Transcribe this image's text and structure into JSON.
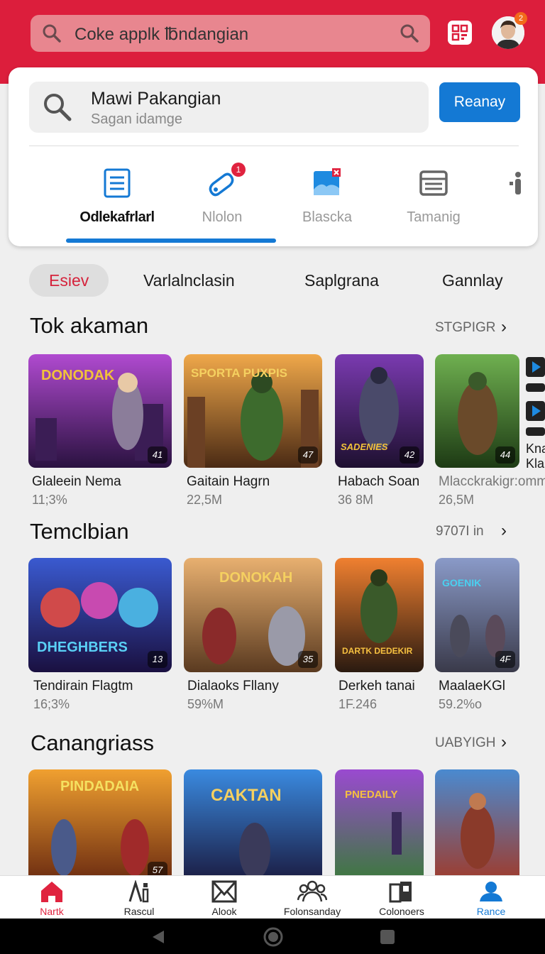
{
  "header": {
    "search_text": "Coke applk ℔ndangian"
  },
  "notification_count": "2",
  "card": {
    "search_title": "Mawi Pakangian",
    "search_sub": "Sagan idamge",
    "button": "Reanay",
    "tabs": [
      {
        "label": "Odlekafrlarl",
        "icon": "document-icon",
        "active": true
      },
      {
        "label": "Nlolon",
        "icon": "controller-icon",
        "badge": "1"
      },
      {
        "label": "Blascka",
        "icon": "image-icon"
      },
      {
        "label": "Tamanig",
        "icon": "folder-icon"
      }
    ]
  },
  "chips": [
    "Esiev",
    "Varlalnclasin",
    "Saplgrana",
    "Gannlay"
  ],
  "sections": [
    {
      "title": "Tok akaman",
      "more": "STGPIGR",
      "items": [
        {
          "name": "Glaleein Nema",
          "size": "11;3%",
          "badge": "41",
          "art": "DONODAK"
        },
        {
          "name": "Gaitain Hagrn",
          "size": "22,5M",
          "badge": "47",
          "art": "SPORTA PUXPIS"
        },
        {
          "name": "Habach Soan",
          "size": "36 8M",
          "badge": "42",
          "art": "SADENIES"
        },
        {
          "name": "Mlacckrakigr:omm",
          "size": "26,5M",
          "badge": "44",
          "art": ""
        }
      ],
      "peek_text": [
        "Kna",
        "Kla"
      ]
    },
    {
      "title": "Temclbian",
      "more": "9707I in",
      "items": [
        {
          "name": "Tendirain Flagtm",
          "size": "16;3%",
          "badge": "13",
          "art": "DHEGHBERS"
        },
        {
          "name": "Dialaoks Fllany",
          "size": "59%M",
          "badge": "35",
          "art": "DONOKAH"
        },
        {
          "name": "Derkeh tanai",
          "size": "1F.246",
          "badge": "",
          "art": "DARTK DEDEKIR"
        },
        {
          "name": "MaalaeKGl",
          "size": "59.2%o",
          "badge": "4F",
          "art": "GOENIK"
        }
      ]
    },
    {
      "title": "Canangriass",
      "more": "UABYIGH",
      "items": [
        {
          "art": "PINDADAIA",
          "badge": "57"
        },
        {
          "art": "CAKTAN",
          "badge": ""
        },
        {
          "art": "PNEDAILY",
          "badge": ""
        },
        {
          "art": "",
          "badge": ""
        }
      ]
    }
  ],
  "bottom_nav": [
    {
      "label": "Nartk",
      "icon": "home-icon",
      "active": true
    },
    {
      "label": "Rascul",
      "icon": "info-icon"
    },
    {
      "label": "Alook",
      "icon": "mail-icon"
    },
    {
      "label": "Folonsanday",
      "icon": "people-icon"
    },
    {
      "label": "Colonoers",
      "icon": "library-icon"
    },
    {
      "label": "Rance",
      "icon": "profile-icon"
    }
  ],
  "colors": {
    "brand_red": "#dc1e3c",
    "accent_blue": "#1479d4",
    "chip_active_text": "#d5233c"
  }
}
